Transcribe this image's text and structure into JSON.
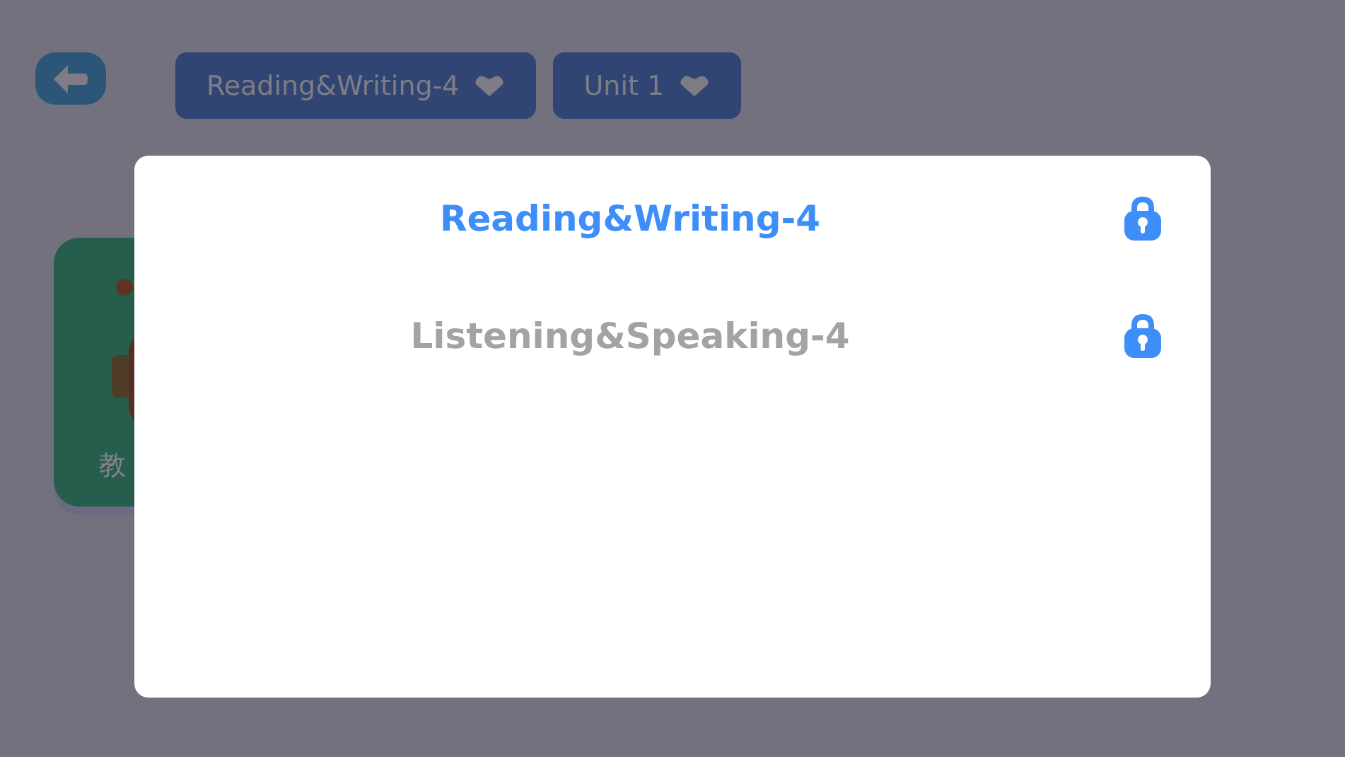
{
  "top_bar": {
    "selectors": [
      {
        "label": "Reading&Writing-4"
      },
      {
        "label": "Unit 1"
      }
    ]
  },
  "card": {
    "label": "教"
  },
  "dialog": {
    "items": [
      {
        "label": "Reading&Writing-4",
        "selected": true,
        "locked": true
      },
      {
        "label": "Listening&Speaking-4",
        "selected": false,
        "locked": true
      }
    ]
  }
}
